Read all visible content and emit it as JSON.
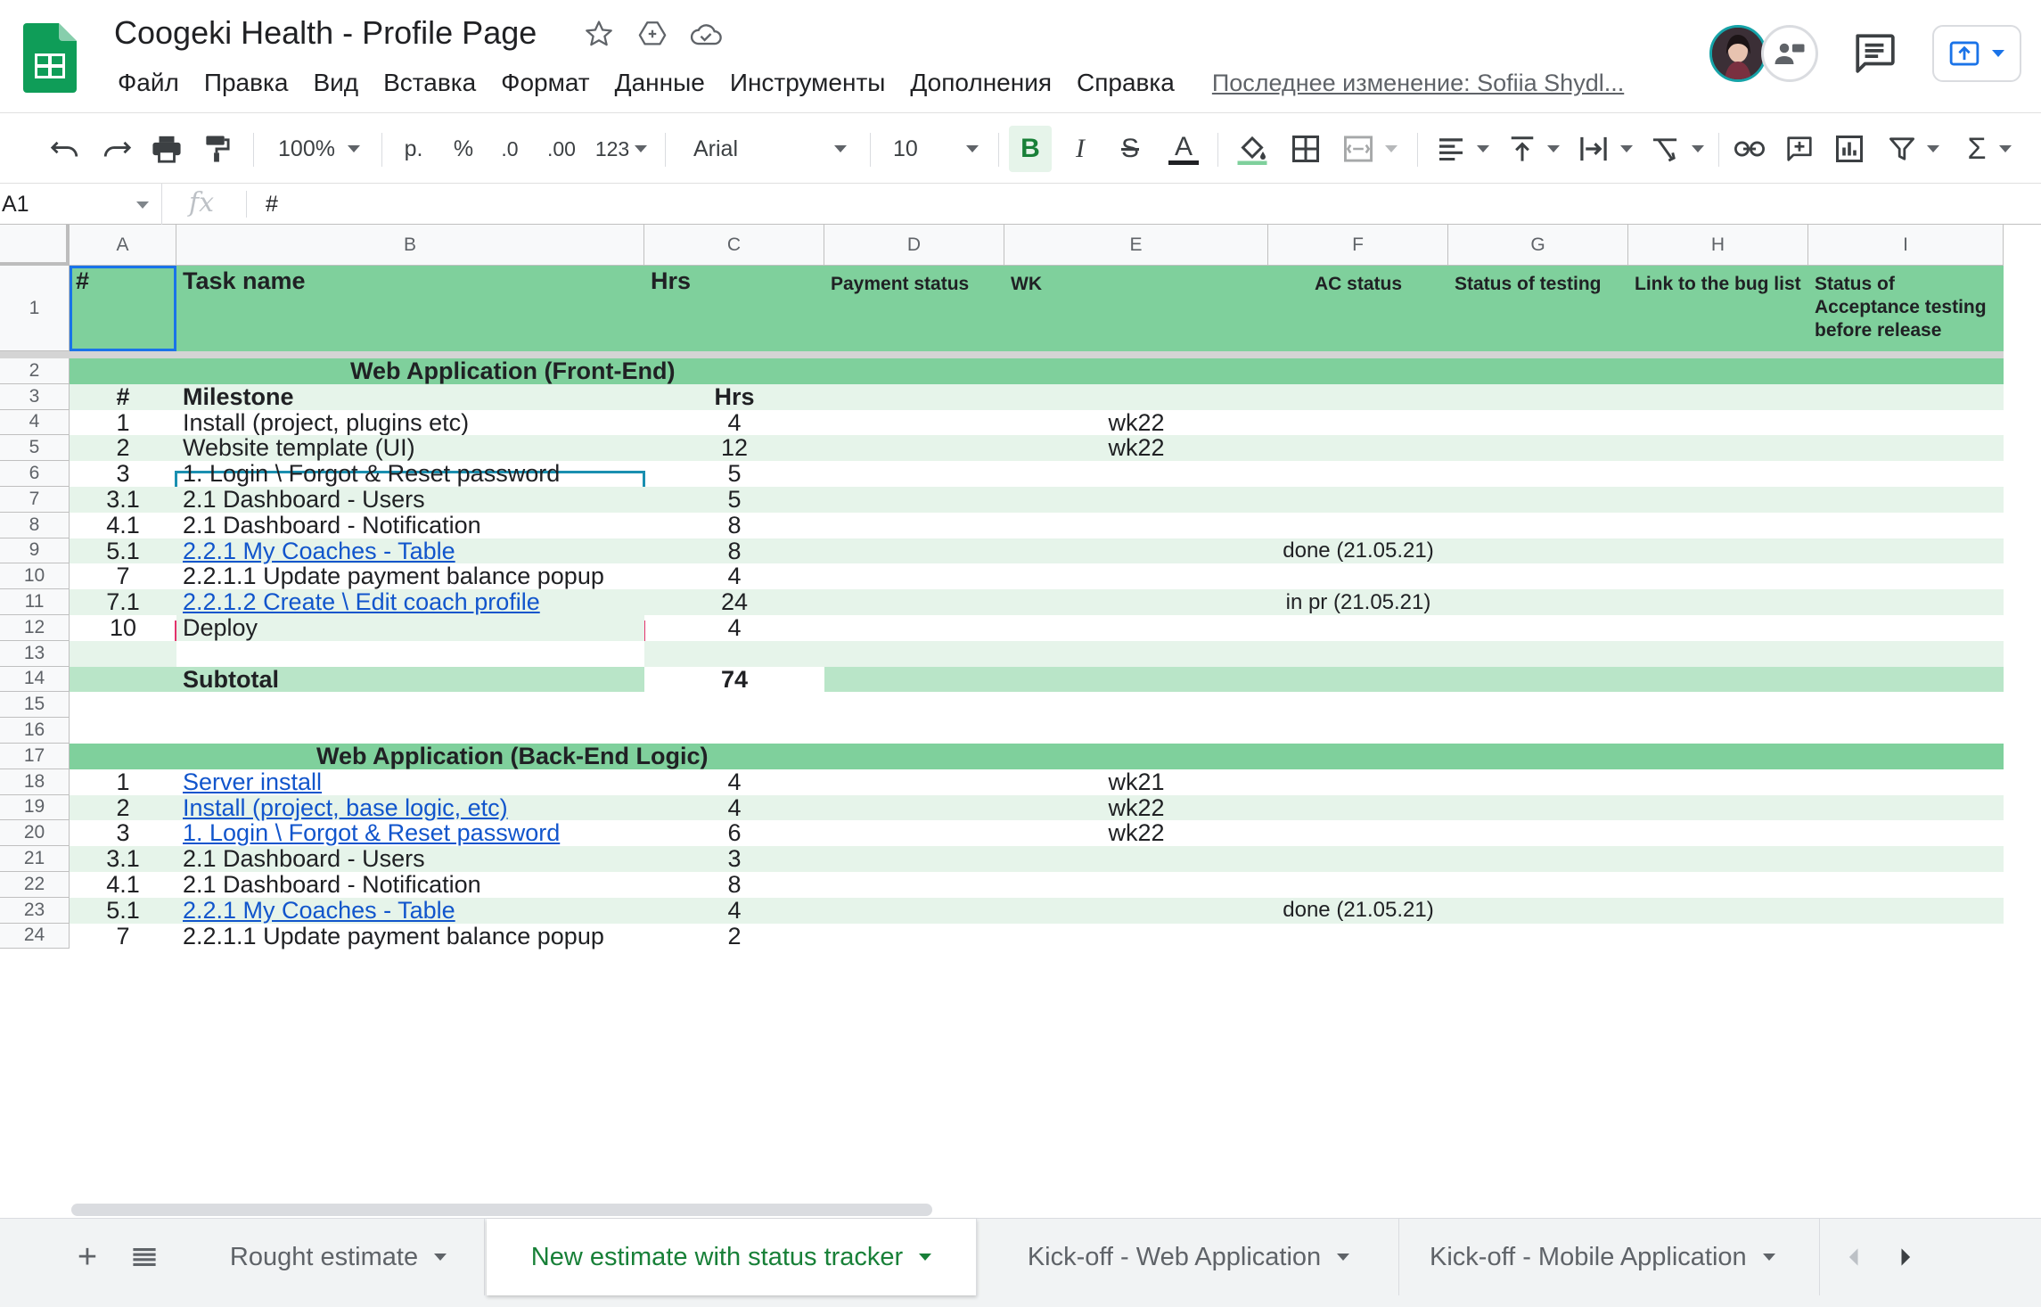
{
  "doc": {
    "title": "Coogeki Health - Profile Page"
  },
  "menu": {
    "items": [
      "Файл",
      "Правка",
      "Вид",
      "Вставка",
      "Формат",
      "Данные",
      "Инструменты",
      "Дополнения",
      "Справка"
    ],
    "last_edit": "Последнее изменение: Sofiia Shydl..."
  },
  "toolbar": {
    "zoom": "100%",
    "currency": "р.",
    "percent": "%",
    "dec_decrease": ".0",
    "dec_increase": ".00",
    "more_formats": "123",
    "font": "Arial",
    "font_size": "10",
    "bold": "B",
    "italic": "I",
    "strike": "S",
    "text_color": "A",
    "sum": "Σ"
  },
  "formula_bar": {
    "cell_ref": "A1",
    "fx": "fx",
    "value": "#"
  },
  "columns": [
    "A",
    "B",
    "C",
    "D",
    "E",
    "F",
    "G",
    "H",
    "I"
  ],
  "header_row": {
    "num": "#",
    "task": "Task name",
    "hrs": "Hrs",
    "payment": "Payment status",
    "wk": "WK",
    "ac": "AC status",
    "testing": "Status of testing",
    "buglist": "Link to the bug list",
    "acceptance": "Status of Acceptance testing before release"
  },
  "rows": [
    {
      "n": "2",
      "a": "",
      "b": "Web Application (Front-End)",
      "c": "",
      "e": "",
      "f": ""
    },
    {
      "n": "3",
      "a": "#",
      "b": "Milestone",
      "c": "Hrs",
      "e": "",
      "f": ""
    },
    {
      "n": "4",
      "a": "1",
      "b": "Install (project, plugins etc)",
      "c": "4",
      "e": "wk22",
      "f": ""
    },
    {
      "n": "5",
      "a": "2",
      "b": "Website template (UI)",
      "c": "12",
      "e": "wk22",
      "f": ""
    },
    {
      "n": "6",
      "a": "3",
      "b": "1. Login \\ Forgot & Reset password",
      "c": "5",
      "e": "",
      "f": ""
    },
    {
      "n": "7",
      "a": "3.1",
      "b": "2.1 Dashboard - Users",
      "c": "5",
      "e": "",
      "f": ""
    },
    {
      "n": "8",
      "a": "4.1",
      "b": "2.1 Dashboard - Notification",
      "c": "8",
      "e": "",
      "f": ""
    },
    {
      "n": "9",
      "a": "5.1",
      "b": "2.2.1 My Coaches - Table",
      "c": "8",
      "e": "",
      "f": "done (21.05.21)"
    },
    {
      "n": "10",
      "a": "7",
      "b": "2.2.1.1 Update payment balance popup",
      "c": "4",
      "e": "",
      "f": ""
    },
    {
      "n": "11",
      "a": "7.1",
      "b": "2.2.1.2 Create \\ Edit coach profile",
      "c": "24",
      "e": "",
      "f": "in pr (21.05.21)"
    },
    {
      "n": "12",
      "a": "10",
      "b": "Deploy",
      "c": "4",
      "e": "",
      "f": ""
    },
    {
      "n": "13",
      "a": "",
      "b": "",
      "c": "",
      "e": "",
      "f": ""
    },
    {
      "n": "14",
      "a": "",
      "b": "Subtotal",
      "c": "74",
      "e": "",
      "f": ""
    },
    {
      "n": "15",
      "a": "",
      "b": "",
      "c": "",
      "e": "",
      "f": ""
    },
    {
      "n": "16",
      "a": "",
      "b": "",
      "c": "",
      "e": "",
      "f": ""
    },
    {
      "n": "17",
      "a": "",
      "b": "Web Application (Back-End Logic)",
      "c": "",
      "e": "",
      "f": ""
    },
    {
      "n": "18",
      "a": "1",
      "b": "Server install",
      "c": "4",
      "e": "wk21",
      "f": ""
    },
    {
      "n": "19",
      "a": "2",
      "b": "Install (project, base logic, etc)",
      "c": "4",
      "e": "wk22",
      "f": ""
    },
    {
      "n": "20",
      "a": "3",
      "b": "1. Login \\ Forgot & Reset password",
      "c": "6",
      "e": "wk22",
      "f": ""
    },
    {
      "n": "21",
      "a": "3.1",
      "b": "2.1 Dashboard - Users",
      "c": "3",
      "e": "",
      "f": ""
    },
    {
      "n": "22",
      "a": "4.1",
      "b": "2.1 Dashboard - Notification",
      "c": "8",
      "e": "",
      "f": ""
    },
    {
      "n": "23",
      "a": "5.1",
      "b": "2.2.1 My Coaches - Table",
      "c": "4",
      "e": "",
      "f": "done (21.05.21)"
    },
    {
      "n": "24",
      "a": "7",
      "b": "2.2.1.1 Update payment balance popup",
      "c": "2",
      "e": "",
      "f": ""
    }
  ],
  "sheets": {
    "add": "+",
    "tabs": [
      "Rought estimate",
      "New estimate with status tracker",
      "Kick-off - Web Application",
      "Kick-off - Mobile Application"
    ],
    "active": 1
  },
  "colors": {
    "header_green": "#7fd09c",
    "light_green": "#e6f4ea",
    "subtotal_green": "#b9e5c8",
    "accent_green": "#188038",
    "link_blue": "#1155cc",
    "selection_blue": "#1a73e8",
    "teal_border": "#1a8fb0",
    "pink_border": "#e2336b"
  }
}
